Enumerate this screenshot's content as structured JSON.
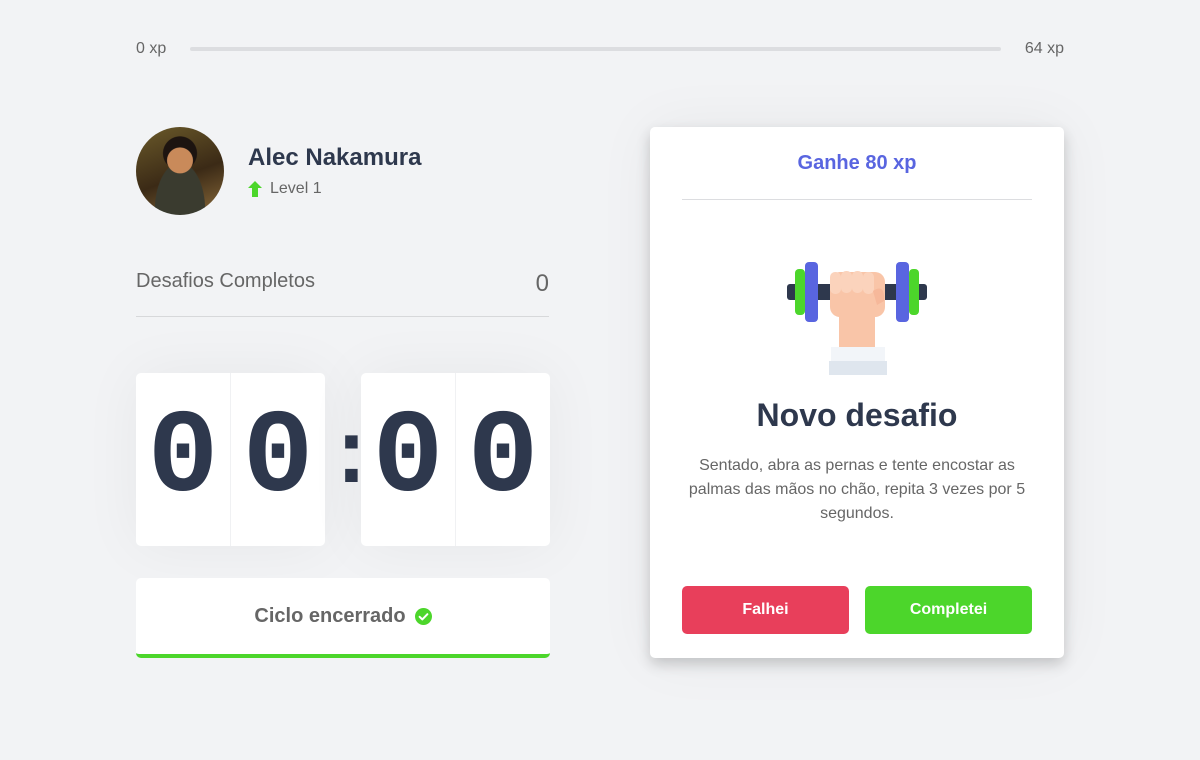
{
  "xp": {
    "current_label": "0 xp",
    "max_label": "64 xp",
    "progress_fraction": 0,
    "bar_color": "#4cd62b"
  },
  "profile": {
    "name": "Alec Nakamura",
    "level": "Level 1",
    "avatar_icon": "user-photo",
    "level_icon": "level-up-arrow-icon"
  },
  "challenges": {
    "label": "Desafios Completos",
    "count": "0"
  },
  "countdown": {
    "minute_left": "0",
    "minute_right": "0",
    "separator": ":",
    "second_left": "0",
    "second_right": "0"
  },
  "cycle": {
    "label": "Ciclo encerrado",
    "icon": "check-circle-icon"
  },
  "challenge_card": {
    "reward": "Ganhe 80 xp",
    "illustration_icon": "dumbbell-body-icon",
    "title": "Novo desafio",
    "description": "Sentado, abra as pernas e tente encostar as palmas das mãos no chão, repita 3 vezes por 5 segundos.",
    "fail_label": "Falhei",
    "success_label": "Completei"
  },
  "colors": {
    "background": "#f2f3f5",
    "title": "#2e384d",
    "text": "#666666",
    "blue": "#5965e0",
    "green": "#4cd62b",
    "red": "#e83f5b"
  }
}
